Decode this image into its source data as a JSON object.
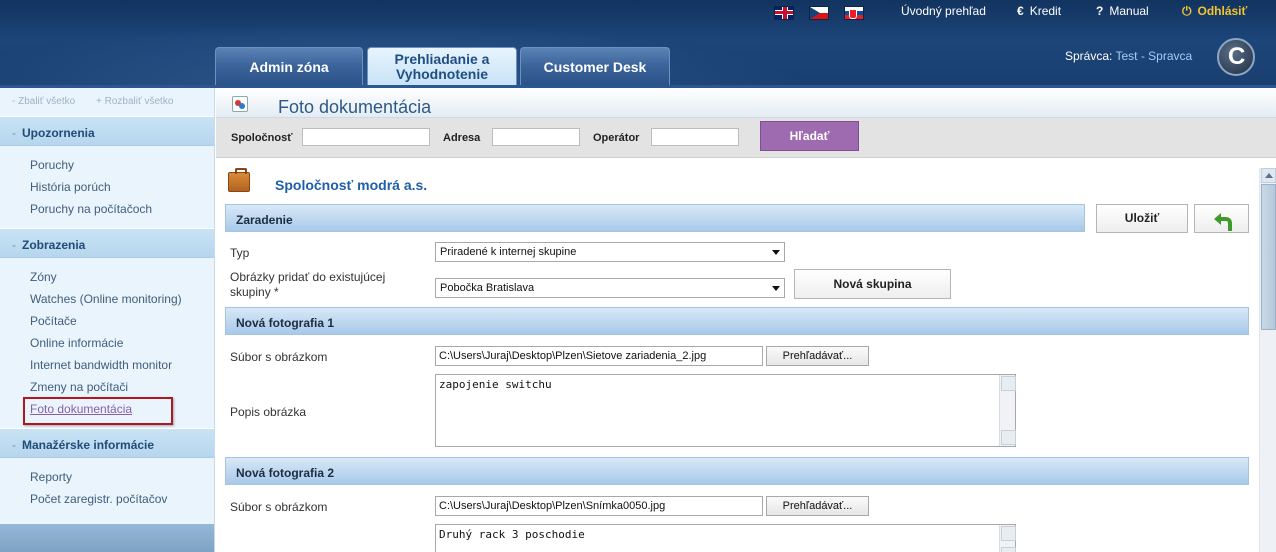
{
  "header": {
    "flags": [
      "flag-uk-icon",
      "flag-cz-icon",
      "flag-sk-icon"
    ],
    "links": {
      "overview": "Úvodný prehľad",
      "credit_icon": "€",
      "credit": "Kredit",
      "manual_icon": "?",
      "manual": "Manual",
      "logout_icon": "⏻",
      "logout": "Odhlásiť"
    },
    "tabs": [
      {
        "label": "Admin zóna"
      },
      {
        "label": "Prehliadanie a Vyhodnotenie"
      },
      {
        "label": "Customer Desk"
      }
    ],
    "admin_prefix": "Správca:",
    "admin_name": "Test - Spravca",
    "logo_letter": "C"
  },
  "sidebar": {
    "collapse_all": "- Zbaliť všetko",
    "expand_all": "+ Rozbaliť všetko",
    "sections": [
      {
        "title": "Upozornenia",
        "items": [
          "Poruchy",
          "História porúch",
          "Poruchy na počítačoch"
        ]
      },
      {
        "title": "Zobrazenia",
        "items": [
          "Zóny",
          "Watches (Online monitoring)",
          "Počítače",
          "Online informácie",
          "Internet bandwidth monitor",
          "Zmeny na počítači",
          "Foto dokumentácia"
        ]
      },
      {
        "title": "Manažérske informácie",
        "items": [
          "Reporty",
          "Počet zaregistr. počítačov"
        ]
      }
    ]
  },
  "page": {
    "title": "Foto dokumentácia",
    "filter": {
      "company_label": "Spoločnosť",
      "address_label": "Adresa",
      "operator_label": "Operátor",
      "company_value": "",
      "address_value": "",
      "operator_value": "",
      "search_button": "Hľadať"
    },
    "company_name": "Spoločnosť modrá a.s.",
    "section_classification": "Zaradenie",
    "save_button": "Uložiť",
    "type_label": "Typ",
    "type_value": "Priradené k internej skupine",
    "group_label": "Obrázky pridať do existujúcej skupiny *",
    "group_value": "Pobočka Bratislava",
    "new_group_button": "Nová skupina",
    "photos": [
      {
        "title": "Nová fotografia 1",
        "file_label": "Súbor s obrázkom",
        "file_value": "C:\\Users\\Juraj\\Desktop\\Plzen\\Sietove zariadenia_2.jpg",
        "browse_label": "Prehľadávať...",
        "desc_label": "Popis obrázka",
        "desc_value": "zapojenie switchu"
      },
      {
        "title": "Nová fotografia 2",
        "file_label": "Súbor s obrázkom",
        "file_value": "C:\\Users\\Juraj\\Desktop\\Plzen\\Snímka0050.jpg",
        "browse_label": "Prehľadávať...",
        "desc_value": "Druhý rack 3 poschodie"
      }
    ]
  }
}
